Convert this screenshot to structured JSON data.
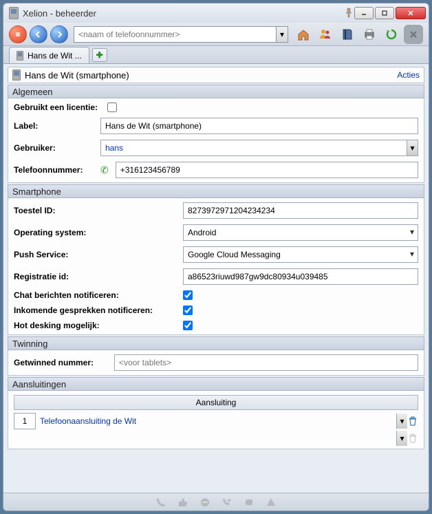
{
  "window": {
    "title": "Xelion - beheerder"
  },
  "search": {
    "placeholder": "<naam of telefoonnummer>"
  },
  "tabs": {
    "main_label": "Hans de Wit ..."
  },
  "header": {
    "title": "Hans de Wit (smartphone)",
    "actions": "Acties"
  },
  "sections": {
    "algemeen": "Algemeen",
    "smartphone": "Smartphone",
    "twinning": "Twinning",
    "aansluitingen": "Aansluitingen"
  },
  "algemeen": {
    "licentie_label": "Gebruikt een licentie:",
    "label_label": "Label:",
    "label_value": "Hans de Wit (smartphone)",
    "gebruiker_label": "Gebruiker:",
    "gebruiker_value": "hans",
    "tel_label": "Telefoonnummer:",
    "tel_value": "+316123456789"
  },
  "smartphone": {
    "toestel_label": "Toestel ID:",
    "toestel_value": "8273972971204234234",
    "os_label": "Operating system:",
    "os_value": "Android",
    "push_label": "Push Service:",
    "push_value": "Google Cloud Messaging",
    "reg_label": "Registratie id:",
    "reg_value": "a86523riuwd987gw9dc80934u039485",
    "chat_label": "Chat berichten notificeren:",
    "incoming_label": "Inkomende gesprekken notificeren:",
    "hotdesk_label": "Hot desking mogelijk:"
  },
  "twinning": {
    "label": "Getwinned nummer:",
    "placeholder": "<voor tablets>"
  },
  "aansluitingen": {
    "col": "Aansluiting",
    "rows": [
      {
        "num": "1",
        "value": "Telefoonaansluiting de Wit"
      }
    ]
  }
}
